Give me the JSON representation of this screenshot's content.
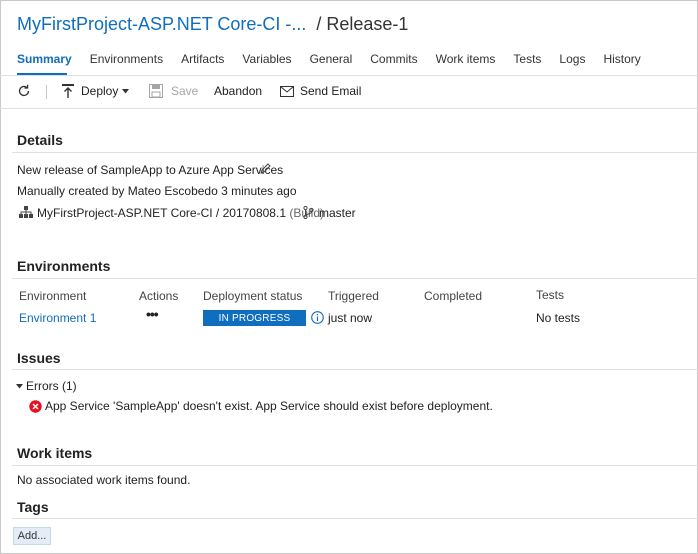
{
  "header": {
    "pipeline_title": "MyFirstProject-ASP.NET Core-CI -...",
    "release_title": "/ Release-1"
  },
  "tabs": [
    {
      "label": "Summary",
      "active": true
    },
    {
      "label": "Environments"
    },
    {
      "label": "Artifacts"
    },
    {
      "label": "Variables"
    },
    {
      "label": "General"
    },
    {
      "label": "Commits"
    },
    {
      "label": "Work items"
    },
    {
      "label": "Tests"
    },
    {
      "label": "Logs"
    },
    {
      "label": "History"
    }
  ],
  "toolbar": {
    "deploy_label": "Deploy",
    "save_label": "Save",
    "abandon_label": "Abandon",
    "send_email_label": "Send Email"
  },
  "details": {
    "title": "Details",
    "description": "New release of SampleApp to Azure App Services",
    "created_by": "Manually created by Mateo Escobedo 3 minutes ago",
    "artifact": "MyFirstProject-ASP.NET Core-CI / 20170808.1",
    "artifact_type": "(Build)",
    "branch": "master"
  },
  "environments": {
    "title": "Environments",
    "columns": {
      "environment": "Environment",
      "actions": "Actions",
      "deployment_status": "Deployment status",
      "triggered": "Triggered",
      "completed": "Completed",
      "tests": "Tests"
    },
    "rows": [
      {
        "environment": "Environment 1",
        "actions": "•••",
        "deployment_status": "IN PROGRESS",
        "triggered": "just now",
        "completed": "",
        "tests": "No tests"
      }
    ]
  },
  "issues": {
    "title": "Issues",
    "errors_label": "Errors (1)",
    "errors": [
      "App Service 'SampleApp' doesn't exist. App Service should exist before deployment."
    ]
  },
  "work_items": {
    "title": "Work items",
    "empty_text": "No associated work items found."
  },
  "tags": {
    "title": "Tags",
    "add_label": "Add..."
  },
  "colors": {
    "accent": "#106ebe",
    "error": "#e81123",
    "badge_bg": "#106ebe"
  }
}
